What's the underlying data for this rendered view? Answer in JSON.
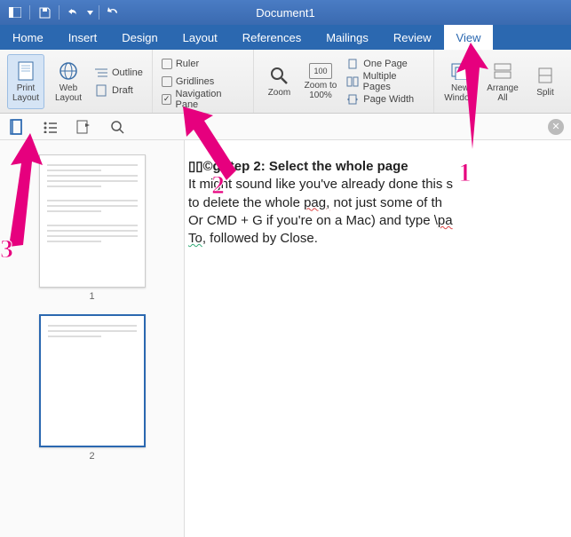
{
  "title": "Document1",
  "tabs": [
    "Home",
    "Insert",
    "Design",
    "Layout",
    "References",
    "Mailings",
    "Review",
    "View"
  ],
  "activeTab": "View",
  "ribbon": {
    "views": {
      "print": "Print\nLayout",
      "web": "Web\nLayout",
      "outline": "Outline",
      "draft": "Draft"
    },
    "show": {
      "ruler": "Ruler",
      "gridlines": "Gridlines",
      "navpane": "Navigation Pane"
    },
    "zoom": {
      "zoom": "Zoom",
      "zoom100": "Zoom to\n100%",
      "onepage": "One Page",
      "multipage": "Multiple Pages",
      "pagewidth": "Page Width"
    },
    "window": {
      "neww": "New\nWindow",
      "arrange": "Arrange\nAll",
      "split": "Split"
    }
  },
  "navpane": {
    "pages": [
      "1",
      "2"
    ],
    "selected": 2
  },
  "document": {
    "heading_prefix": "▯▯©g",
    "heading": "Step 2: Select the whole page",
    "line1a": "It might sound like you've already done this s",
    "line2a": "to delete the whole ",
    "line2b": "pag,",
    "line2c": " not just some of th",
    "line3a": "Or CMD + G if you're on a Mac) and type \\",
    "line3b": "pa",
    "line4a": "To",
    "line4b": ", followed by Close."
  },
  "annotations": {
    "n1": "1",
    "n2": "2",
    "n3": "3"
  }
}
